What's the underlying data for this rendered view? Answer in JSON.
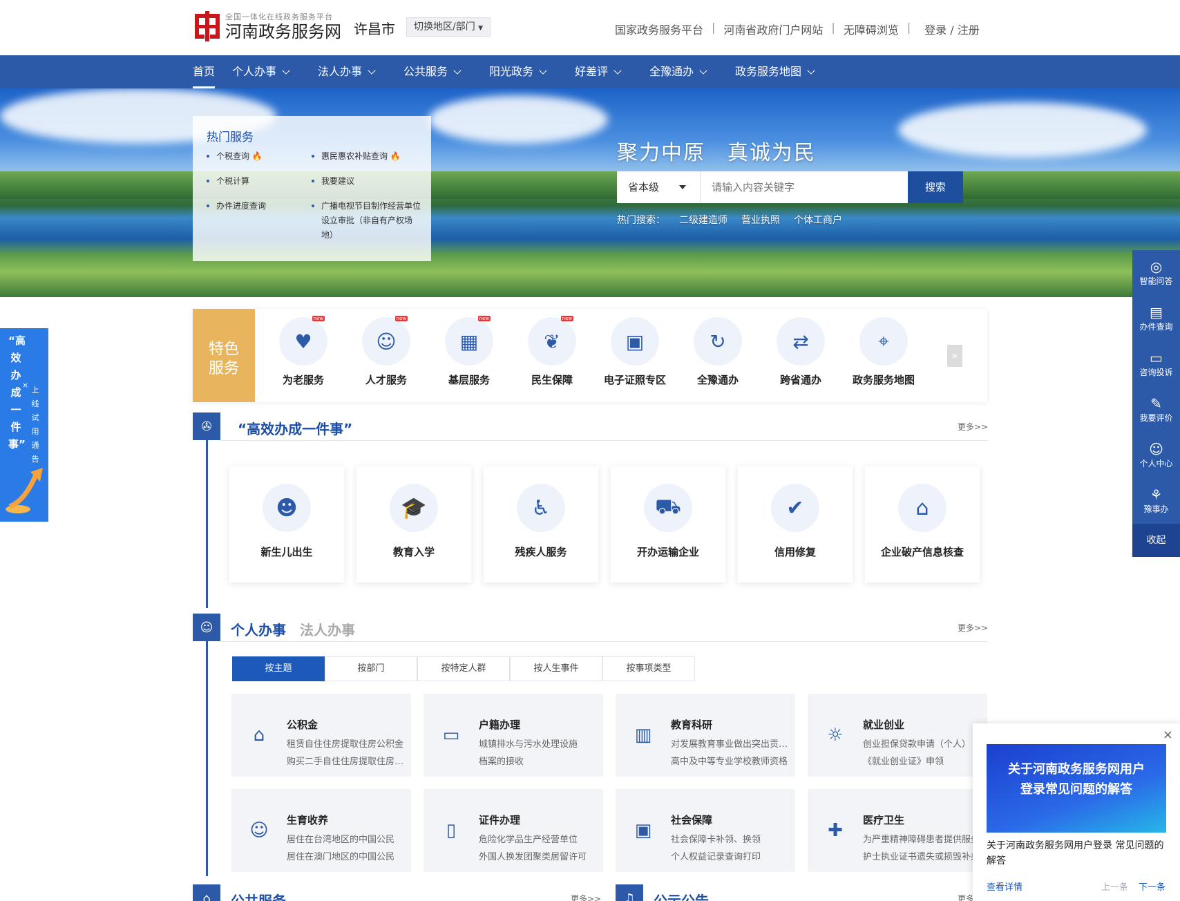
{
  "header": {
    "logo_sub": "全国一体化在线政务服务平台",
    "logo_main": "河南政务服务网",
    "city": "许昌市",
    "switch_label": "切换地区/部门",
    "links": [
      "国家政务服务平台",
      "河南省政府门户网站",
      "无障碍浏览",
      "登录 / 注册"
    ]
  },
  "nav": [
    "首页",
    "个人办事",
    "法人办事",
    "公共服务",
    "阳光政务",
    "好差评",
    "全豫通办",
    "政务服务地图"
  ],
  "hot_services": {
    "title": "热门服务",
    "items": [
      "个税查询",
      "惠民惠农补贴查询",
      "个税计算",
      "我要建议",
      "办件进度查询",
      "广播电视节目制作经营单位设立审批（非自有产权场地）"
    ]
  },
  "banner": {
    "slogan": "聚力中原　真诚为民",
    "level": "省本级",
    "search_placeholder": "请输入内容关键字",
    "search_button": "搜索",
    "hot_search_label": "热门搜索：",
    "hot_search": [
      "二级建造师",
      "营业执照",
      "个体工商户"
    ]
  },
  "right_sidebar": [
    "智能问答",
    "办件查询",
    "咨询投诉",
    "我要评价",
    "个人中心",
    "豫事办"
  ],
  "right_sidebar_collapse": "收起",
  "left_float": {
    "big": "“高效办成一件事”",
    "small": "上线试用通告",
    "close": "×"
  },
  "special": {
    "title": "特色服务",
    "items": [
      {
        "label": "为老服务",
        "icon": "heart-icon",
        "new": true
      },
      {
        "label": "人才服务",
        "icon": "person-icon",
        "new": true
      },
      {
        "label": "基层服务",
        "icon": "building-icon",
        "new": true
      },
      {
        "label": "民生保障",
        "icon": "care-icon",
        "new": true
      },
      {
        "label": "电子证照专区",
        "icon": "id-card-icon",
        "new": false
      },
      {
        "label": "全豫通办",
        "icon": "refresh-icon",
        "new": false
      },
      {
        "label": "跨省通办",
        "icon": "transfer-icon",
        "new": false
      },
      {
        "label": "政务服务地图",
        "icon": "map-pin-icon",
        "new": false
      }
    ],
    "new_label": "new",
    "next": "»"
  },
  "efficient": {
    "title": "“高效办成一件事”",
    "more": "更多>>",
    "cards": [
      "新生儿出生",
      "教育入学",
      "残疾人服务",
      "开办运输企业",
      "信用修复",
      "企业破产信息核查"
    ]
  },
  "personal": {
    "title": "个人办事",
    "alt_title": "法人办事",
    "more": "更多>>",
    "tabs": [
      "按主题",
      "按部门",
      "按特定人群",
      "按人生事件",
      "按事项类型"
    ],
    "tiles": [
      {
        "title": "公积金",
        "l1": "租赁自住住房提取住房公积金",
        "l2": "购买二手自住住房提取住房公积金"
      },
      {
        "title": "户籍办理",
        "l1": "城镇排水与污水处理设施",
        "l2": "档案的接收"
      },
      {
        "title": "教育科研",
        "l1": "对发展教育事业做出突出贡献的",
        "l2": "高中及中等专业学校教师资格"
      },
      {
        "title": "就业创业",
        "l1": "创业担保贷款申请（个人）",
        "l2": "《就业创业证》申领"
      },
      {
        "title": "生育收养",
        "l1": "居住在台湾地区的中国公民",
        "l2": "居住在澳门地区的中国公民"
      },
      {
        "title": "证件办理",
        "l1": "危险化学品生产经营单位",
        "l2": "外国人换发团聚类居留许可"
      },
      {
        "title": "社会保障",
        "l1": "社会保障卡补领、换领",
        "l2": "个人权益记录查询打印"
      },
      {
        "title": "医疗卫生",
        "l1": "为严重精神障碍患者提供服务",
        "l2": "护士执业证书遗失或损毁补办"
      }
    ]
  },
  "bottom": {
    "public_title": "公共服务",
    "public_more": "更多>>",
    "notice_title": "公示公告",
    "notice_more": "更多"
  },
  "notice_popup": {
    "image_text": "关于河南政务服务网用户登录常见问题的解答",
    "text": "关于河南政务服务网用户登录 常见问题的解答",
    "detail": "查看详情",
    "prev": "上一条",
    "next": "下一条",
    "close": "×"
  },
  "colors": {
    "brand": "#2c5aa8",
    "accent": "#e8b55e",
    "logo_red": "#c8161d"
  }
}
